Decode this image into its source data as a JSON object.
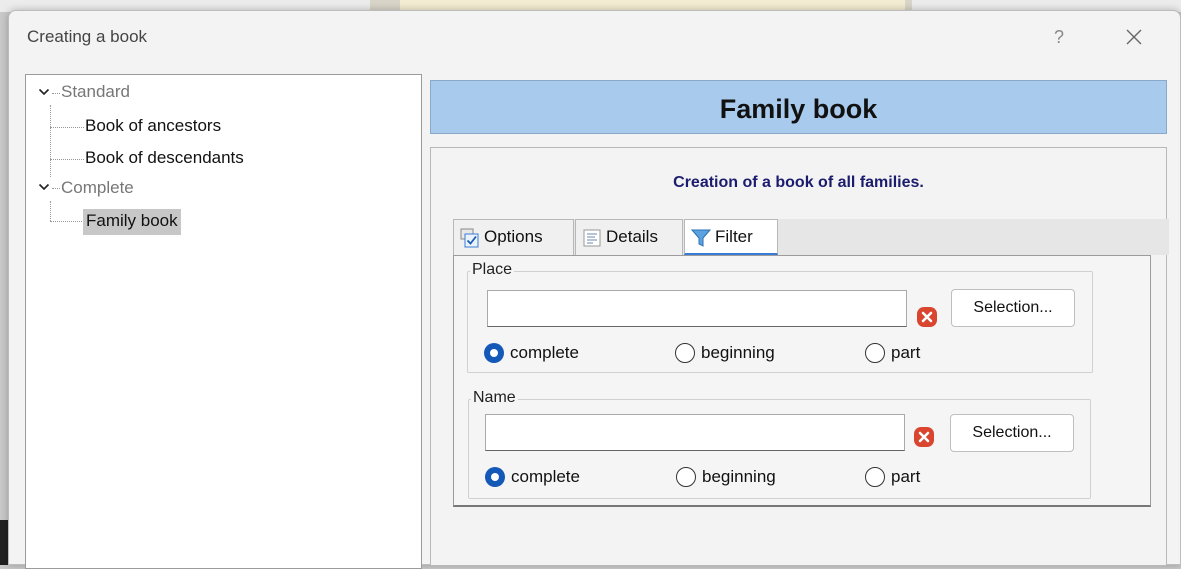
{
  "dialog": {
    "title": "Creating a book",
    "help_label": "?"
  },
  "tree": {
    "items": [
      {
        "label": "Standard",
        "kind": "group",
        "expanded": true
      },
      {
        "label": "Book of ancestors",
        "kind": "leaf"
      },
      {
        "label": "Book of descendants",
        "kind": "leaf"
      },
      {
        "label": "Complete",
        "kind": "group",
        "expanded": true
      },
      {
        "label": "Family book",
        "kind": "leaf",
        "selected": true
      }
    ]
  },
  "main": {
    "header_title": "Family book",
    "subtitle": "Creation of a book of all families.",
    "tabs": [
      {
        "label": "Options",
        "icon": "checkbox-icon"
      },
      {
        "label": "Details",
        "icon": "details-icon"
      },
      {
        "label": "Filter",
        "icon": "funnel-icon",
        "active": true
      }
    ],
    "filter": {
      "place": {
        "label": "Place",
        "value": "",
        "selection_button": "Selection...",
        "options": [
          "complete",
          "beginning",
          "part"
        ],
        "selected": "complete"
      },
      "name": {
        "label": "Name",
        "value": "",
        "selection_button": "Selection...",
        "options": [
          "complete",
          "beginning",
          "part"
        ],
        "selected": "complete"
      }
    }
  },
  "colors": {
    "header_band": "#a8cbed",
    "subtitle": "#1c1c6e",
    "radio_checked": "#1459b8",
    "clear_icon": "#d9452f"
  }
}
